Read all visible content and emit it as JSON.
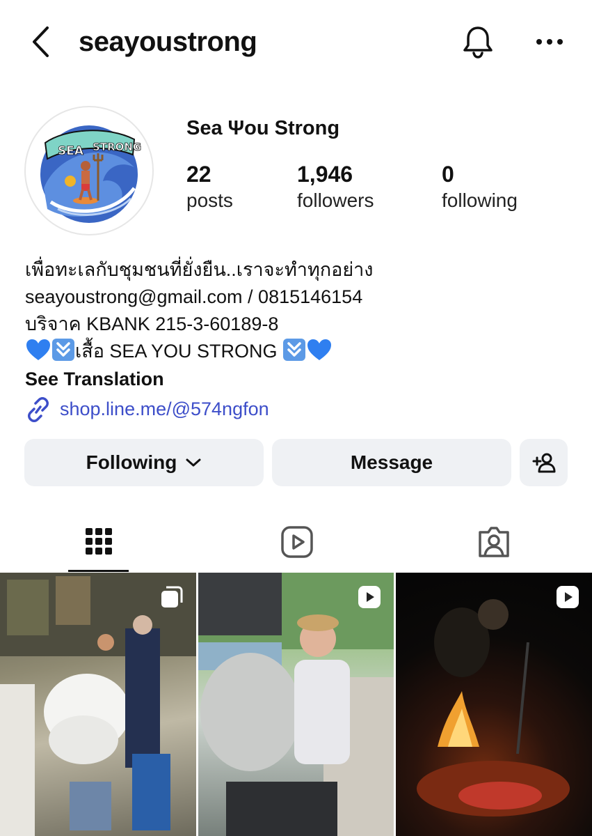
{
  "header": {
    "username": "seayoustrong",
    "back_icon": "chevron-left-icon",
    "bell_icon": "bell-icon",
    "more_icon": "more-horizontal-icon"
  },
  "profile": {
    "display_name": "Sea Ψou Strong",
    "stats": {
      "posts": {
        "count": "22",
        "label": "posts"
      },
      "followers": {
        "count": "1,946",
        "label": "followers"
      },
      "following": {
        "count": "0",
        "label": "following"
      }
    }
  },
  "bio": {
    "line1": "เพื่อทะเลกับชุมชนที่ยั่งยืน..เราจะทำทุกอย่าง",
    "line2": "seayoustrong@gmail.com / 0815146154",
    "line3": "บริจาค KBANK 215-3-60189-8",
    "line4": "เสื้อ SEA YOU STRONG ",
    "see_translation": "See Translation",
    "link": "shop.line.me/@574ngfon"
  },
  "buttons": {
    "following": "Following",
    "message": "Message"
  },
  "tabs": [
    "posts-grid",
    "reels",
    "tagged"
  ],
  "posts": [
    {
      "type": "carousel",
      "badge_icon": "carousel-icon"
    },
    {
      "type": "reel",
      "badge_icon": "reel-icon"
    },
    {
      "type": "reel",
      "badge_icon": "reel-icon"
    }
  ],
  "colors": {
    "accent_link": "#3d4ec9",
    "button_bg": "#eff1f4",
    "heart_blue": "#2f7ff0",
    "arrow_box": "#5c9ae6"
  }
}
